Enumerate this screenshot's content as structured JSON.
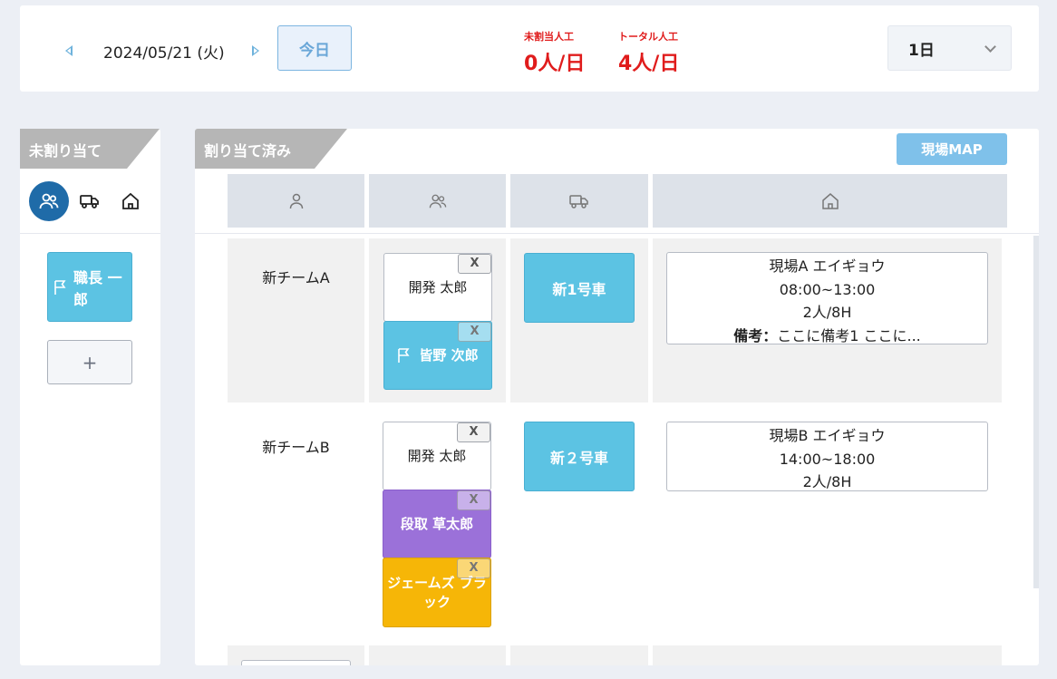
{
  "header": {
    "date": "2024/05/21 (火)",
    "today_label": "今日",
    "unassigned_label": "未割当人工",
    "unassigned_value": "0人/日",
    "total_label": "トータル人工",
    "total_value": "4人/日",
    "period_value": "1日"
  },
  "left": {
    "title": "未割り当て",
    "tabs": [
      "people-icon",
      "truck-icon",
      "home-icon"
    ],
    "cards": [
      {
        "name": "職長 一郎"
      }
    ],
    "add_label": "+"
  },
  "right": {
    "title": "割り当て済み",
    "map_button": "現場MAP",
    "columns": [
      "person-icon",
      "people-icon",
      "truck-icon",
      "home-icon"
    ],
    "teams": [
      {
        "name": "新チームA",
        "members": [
          {
            "name": "開発 太郎",
            "style": "white",
            "remove": "X"
          },
          {
            "name": "皆野 次郎",
            "style": "cyan",
            "remove": "X"
          }
        ],
        "vehicle": "新1号車",
        "site": {
          "name": "現場A エイギョウ",
          "time": "08:00~13:00",
          "workload": "2人/8H",
          "note_label": "備考：",
          "note": "ここに備考1 ここに..."
        }
      },
      {
        "name": "新チームB",
        "members": [
          {
            "name": "開発 太郎",
            "style": "white",
            "remove": "X"
          },
          {
            "name": "段取 草太郎",
            "style": "purple",
            "remove": "X"
          },
          {
            "name": "ジェームズ ブラック",
            "style": "yellow",
            "remove": "X"
          }
        ],
        "vehicle": "新２号車",
        "site": {
          "name": "現場B エイギョウ",
          "time": "14:00~18:00",
          "workload": "2人/8H"
        }
      }
    ]
  },
  "colors": {
    "accent": "#1f6ba8",
    "card_cyan": "#5cc3e3",
    "card_purple": "#9b71d9",
    "card_yellow": "#f6b607",
    "stat_red": "#e01c1c"
  }
}
